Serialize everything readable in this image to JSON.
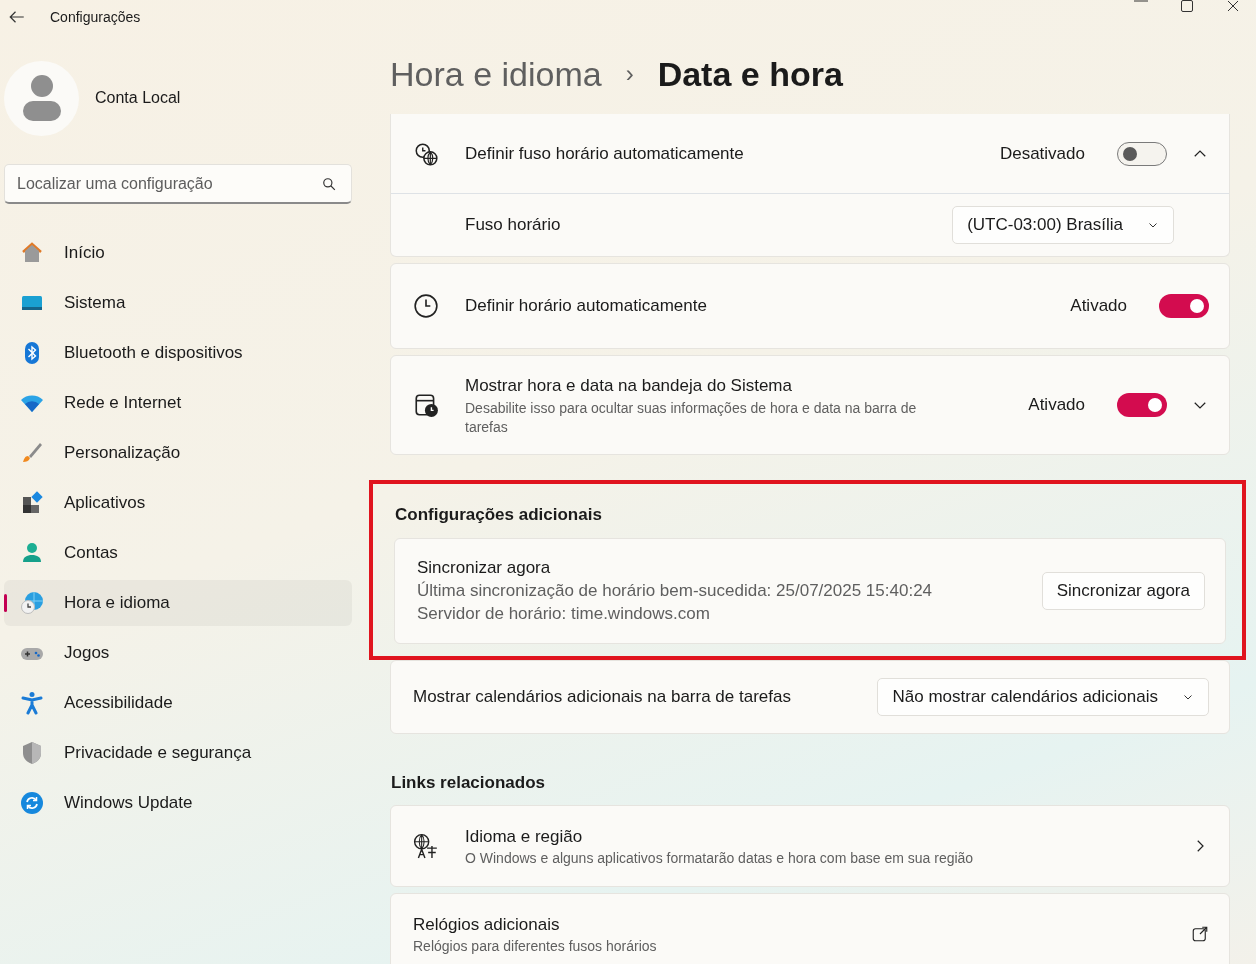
{
  "window": {
    "title": "Configurações"
  },
  "account": {
    "name": "Conta Local"
  },
  "search": {
    "placeholder": "Localizar uma configuração"
  },
  "nav": [
    {
      "label": "Início",
      "selected": false
    },
    {
      "label": "Sistema",
      "selected": false
    },
    {
      "label": "Bluetooth e dispositivos",
      "selected": false
    },
    {
      "label": "Rede e Internet",
      "selected": false
    },
    {
      "label": "Personalização",
      "selected": false
    },
    {
      "label": "Aplicativos",
      "selected": false
    },
    {
      "label": "Contas",
      "selected": false
    },
    {
      "label": "Hora e idioma",
      "selected": true
    },
    {
      "label": "Jogos",
      "selected": false
    },
    {
      "label": "Acessibilidade",
      "selected": false
    },
    {
      "label": "Privacidade e segurança",
      "selected": false
    },
    {
      "label": "Windows Update",
      "selected": false
    }
  ],
  "breadcrumb": {
    "parent": "Hora e idioma",
    "separator": "›",
    "current": "Data e hora"
  },
  "sections": [
    {
      "cards": [
        {
          "kind": "toggle",
          "title": "Definir fuso horário automaticamente",
          "state_text": "Desativado",
          "on": false,
          "expanded": true,
          "children": [
            {
              "label": "Fuso horário",
              "dropdown": "(UTC-03:00) Brasília"
            }
          ]
        },
        {
          "kind": "toggle",
          "title": "Definir horário automaticamente",
          "state_text": "Ativado",
          "on": true
        },
        {
          "kind": "toggle",
          "title": "Mostrar hora e data na bandeja do Sistema",
          "description": "Desabilite isso para ocultar suas informações de hora e data na barra de tarefas",
          "state_text": "Ativado",
          "on": true,
          "expanded": false
        }
      ]
    },
    {
      "heading": "Configurações adicionais",
      "highlighted": true,
      "cards": [
        {
          "kind": "button",
          "title": "Sincronizar agora",
          "lines": [
            "Última sincronização de horário bem-sucedida: 25/07/2025 15:40:24",
            "Servidor de horário: time.windows.com"
          ],
          "button": "Sincronizar agora"
        }
      ]
    },
    {
      "cards": [
        {
          "kind": "dropdown",
          "title": "Mostrar calendários adicionais na barra de tarefas",
          "dropdown": "Não mostrar calendários adicionais"
        }
      ]
    },
    {
      "heading": "Links relacionados",
      "cards": [
        {
          "kind": "link",
          "title": "Idioma e região",
          "description": "O Windows e alguns aplicativos formatarão datas e hora com base em sua região"
        },
        {
          "kind": "link",
          "title": "Relógios adicionais",
          "description": "Relógios para diferentes fusos horários"
        }
      ]
    }
  ]
}
